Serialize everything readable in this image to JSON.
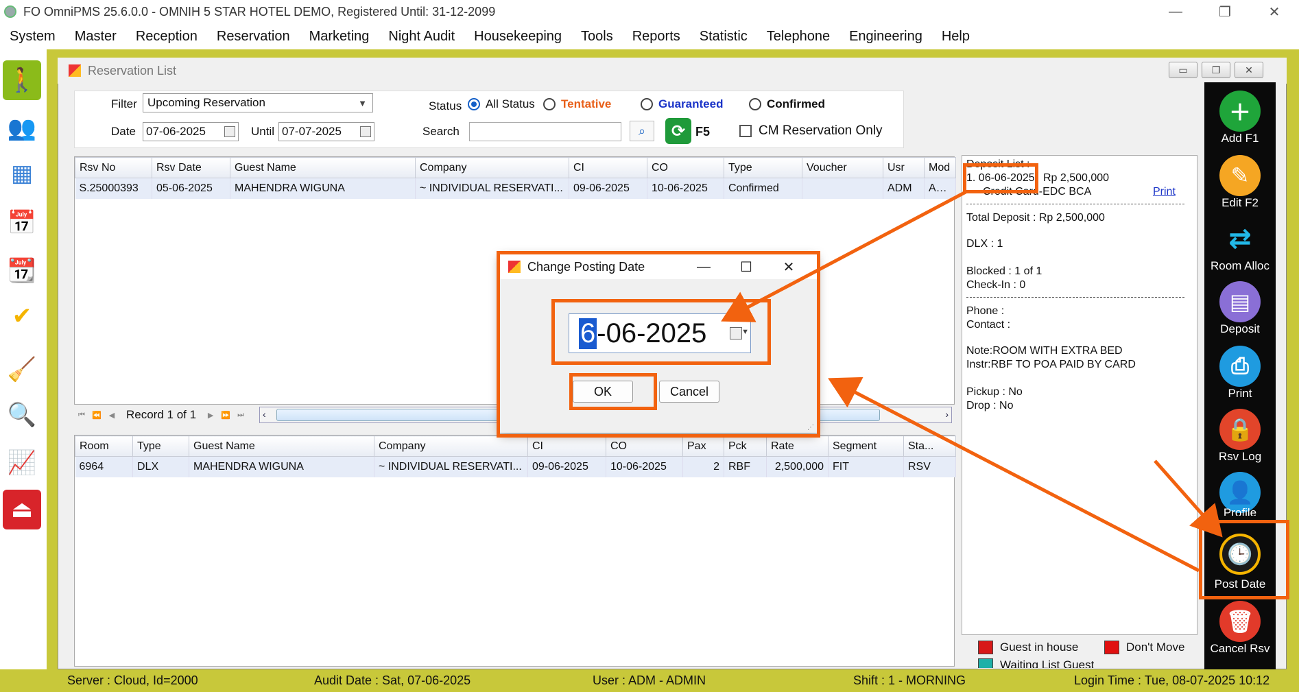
{
  "window": {
    "title": "FO OmniPMS 25.6.0.0 - OMNIH 5 STAR HOTEL DEMO, Registered Until: 31-12-2099",
    "minimize": "—",
    "maximize": "❐",
    "close": "✕"
  },
  "menu": [
    "System",
    "Master",
    "Reception",
    "Reservation",
    "Marketing",
    "Night Audit",
    "Housekeeping",
    "Tools",
    "Reports",
    "Statistic",
    "Telephone",
    "Engineering",
    "Help"
  ],
  "child_window": {
    "title": "Reservation List"
  },
  "filter": {
    "filter_label": "Filter",
    "filter_value": "Upcoming Reservation",
    "date_label": "Date",
    "date_value": "07-06-2025",
    "until_label": "Until",
    "until_value": "07-07-2025",
    "status_label": "Status",
    "status_options": [
      "All Status",
      "Tentative",
      "Guaranteed",
      "Confirmed"
    ],
    "status_selected": "All Status",
    "search_label": "Search",
    "search_value": "",
    "refresh_key": "F5",
    "cm_only_label": "CM Reservation Only"
  },
  "reservations": {
    "columns": [
      "Rsv No",
      "Rsv Date",
      "Guest Name",
      "Company",
      "CI",
      "CO",
      "Type",
      "Voucher",
      "Usr",
      "Mod"
    ],
    "rows": [
      [
        "S.25000393",
        "05-06-2025",
        "MAHENDRA WIGUNA",
        "~ INDIVIDUAL RESERVATI...",
        "09-06-2025",
        "10-06-2025",
        "Confirmed",
        "",
        "ADM",
        "ADM"
      ]
    ]
  },
  "navigator": {
    "record_label": "Record 1 of 1"
  },
  "rooms": {
    "columns": [
      "Room",
      "Type",
      "Guest Name",
      "Company",
      "CI",
      "CO",
      "Pax",
      "Pck",
      "Rate",
      "Segment",
      "Sta..."
    ],
    "rows": [
      [
        "6964",
        "DLX",
        "MAHENDRA WIGUNA",
        "~ INDIVIDUAL RESERVATI...",
        "09-06-2025",
        "10-06-2025",
        "2",
        "RBF",
        "2,500,000",
        "FIT",
        "RSV"
      ]
    ]
  },
  "info": {
    "deposit_list": "Deposit List :",
    "deposit_date": "1. 06-06-2025",
    "deposit_amount": "Rp 2,500,000",
    "deposit_method": "Credit Card-EDC BCA",
    "print_link": "Print",
    "total_deposit": "Total Deposit : Rp 2,500,000",
    "room_type_count": "DLX : 1",
    "blocked": "Blocked : 1 of 1",
    "checkin": "Check-In : 0",
    "phone": "Phone :",
    "contact": "Contact :",
    "note": "Note:ROOM WITH EXTRA BED",
    "instr": "Instr:RBF TO POA PAID BY CARD",
    "pickup": "Pickup : No",
    "drop": "Drop : No"
  },
  "legend": {
    "guest_in_house": "Guest in house",
    "guest_in_house_color": "#d81818",
    "dont_move": "Don't Move",
    "dont_move_color": "#e01010",
    "waiting_list": "Waiting List Guest",
    "waiting_list_color": "#1fb0a8"
  },
  "right_toolbar": [
    {
      "label": "Add F1",
      "icon": "plus-icon",
      "color": "#1fa53a"
    },
    {
      "label": "Edit F2",
      "icon": "edit-icon",
      "color": "#f5a623"
    },
    {
      "label": "Room Alloc",
      "icon": "swap-arrows-icon",
      "color": "#0a0a0a"
    },
    {
      "label": "Deposit",
      "icon": "wallet-icon",
      "color": "#8a6fd6"
    },
    {
      "label": "Print",
      "icon": "printer-icon",
      "color": "#1f9be0"
    },
    {
      "label": "Rsv Log",
      "icon": "lock-icon",
      "color": "#e2452a"
    },
    {
      "label": "Profile",
      "icon": "user-icon",
      "color": "#1f9be0"
    },
    {
      "label": "Post Date",
      "icon": "clock-icon",
      "color": "#0a0a0a"
    },
    {
      "label": "Cancel Rsv",
      "icon": "trash-icon",
      "color": "#e23a2a"
    }
  ],
  "left_toolbar": [
    "walk-in-icon",
    "guests-icon",
    "floor-plan-icon",
    "calendar-icon",
    "year-calendar-icon",
    "availability-icon",
    "housekeeping-icon",
    "analysis-icon",
    "statistics-icon",
    "exit-icon"
  ],
  "dialog": {
    "title": "Change Posting Date",
    "date_selected_part": "6",
    "date_rest": "-06-2025",
    "ok_label": "OK",
    "cancel_label": "Cancel",
    "minimize": "—",
    "maximize": "☐",
    "close": "✕"
  },
  "status_bar": {
    "server": "Server : Cloud, Id=2000",
    "audit_date": "Audit Date : Sat, 07-06-2025",
    "user": "User : ADM - ADMIN",
    "shift": "Shift : 1 - MORNING",
    "login_time": "Login Time : Tue, 08-07-2025 10:12"
  },
  "colors": {
    "accent_annotation": "#f2620f",
    "frame_olive": "#c8c83a",
    "selection_blue": "#1a5bd0",
    "tentative": "#e8601a",
    "guaranteed": "#1b34c8"
  }
}
